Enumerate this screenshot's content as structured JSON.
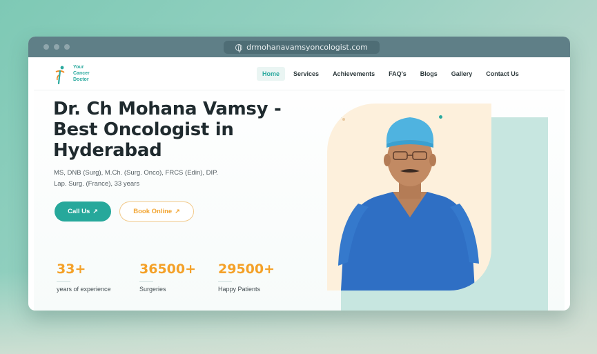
{
  "browser": {
    "url": "drmohanavamsyoncologist.com"
  },
  "logo": {
    "line1": "Your",
    "line2": "Cancer",
    "line3": "Doctor"
  },
  "nav": {
    "items": [
      {
        "label": "Home",
        "active": true
      },
      {
        "label": "Services"
      },
      {
        "label": "Achievements"
      },
      {
        "label": "FAQ's"
      },
      {
        "label": "Blogs"
      },
      {
        "label": "Gallery"
      },
      {
        "label": "Contact Us"
      }
    ]
  },
  "hero": {
    "title_line1": "Dr. Ch Mohana Vamsy -",
    "title_line2": "Best Oncologist in",
    "title_line3": "Hyderabad",
    "creds_line1": "MS, DNB (Surg), M.Ch. (Surg. Onco), FRCS (Edin), DIP.",
    "creds_line2": "Lap. Surg. (France), 33 years",
    "call_label": "Call Us",
    "book_label": "Book Online",
    "arrow": "↗"
  },
  "stats": [
    {
      "value": "33+",
      "label": "years of experience"
    },
    {
      "value": "36500+",
      "label": "Surgeries"
    },
    {
      "value": "29500+",
      "label": "Happy Patients"
    }
  ],
  "colors": {
    "accent": "#26a89b",
    "orange": "#f4a128"
  }
}
